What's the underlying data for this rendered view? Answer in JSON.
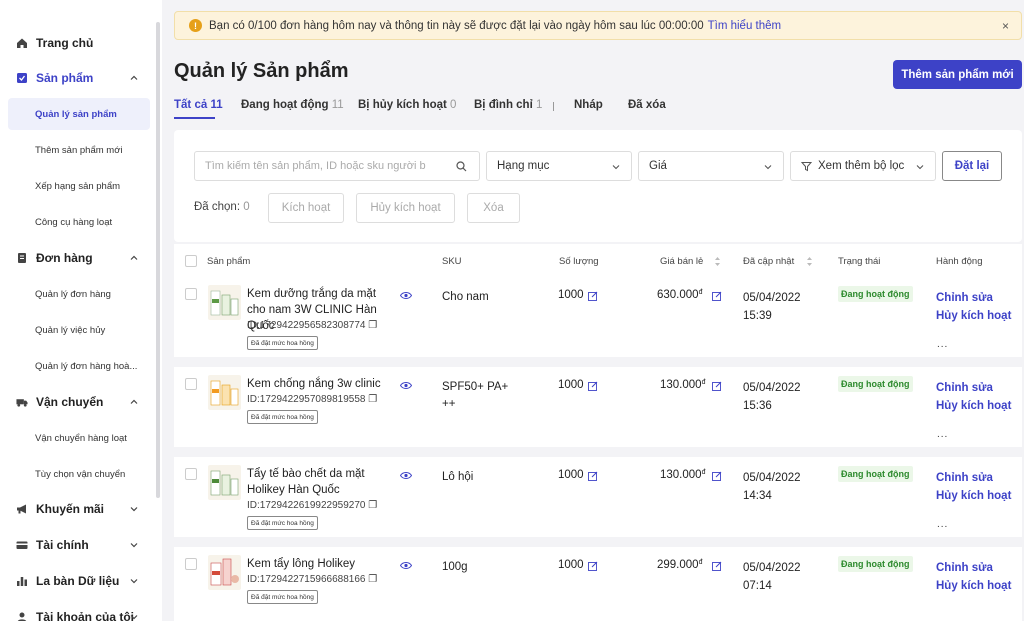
{
  "sidebar": {
    "sections": [
      {
        "label": "Trang chủ",
        "icon": "home-icon"
      },
      {
        "label": "Sản phẩm",
        "icon": "product-icon"
      },
      {
        "label": "Đơn hàng",
        "icon": "order-icon"
      },
      {
        "label": "Vận chuyển",
        "icon": "truck-icon"
      },
      {
        "label": "Khuyến mãi",
        "icon": "megaphone-icon"
      },
      {
        "label": "Tài chính",
        "icon": "card-icon"
      },
      {
        "label": "La bàn Dữ liệu",
        "icon": "bar-chart-icon"
      },
      {
        "label": "Tài khoản của tôi",
        "icon": "user-icon"
      }
    ],
    "product_items": [
      "Quản lý sản phẩm",
      "Thêm sản phẩm mới",
      "Xếp hạng sản phẩm",
      "Công cụ hàng loạt"
    ],
    "order_items": [
      "Quản lý đơn hàng",
      "Quản lý việc hủy",
      "Quản lý đơn hàng hoà..."
    ],
    "shipping_items": [
      "Vận chuyển hàng loạt",
      "Tùy chọn vận chuyển"
    ]
  },
  "banner": {
    "text": "Bạn có 0/100 đơn hàng hôm nay và thông tin này sẽ được đặt lại vào ngày hôm sau lúc 00:00:00",
    "link": "Tìm hiểu thêm",
    "close": "×"
  },
  "page": {
    "title": "Quản lý Sản phẩm",
    "add_button": "Thêm sản phẩm mới"
  },
  "tabs": [
    {
      "label": "Tất cả",
      "count": "11"
    },
    {
      "label": "Đang hoạt động",
      "count": "11"
    },
    {
      "label": "Bị hủy kích hoạt",
      "count": "0"
    },
    {
      "label": "Bị đình chỉ",
      "count": "1"
    },
    {
      "label": "Nháp",
      "count": ""
    },
    {
      "label": "Đã xóa",
      "count": ""
    }
  ],
  "filters": {
    "search_placeholder": "Tìm kiếm tên sản phẩm, ID hoặc sku người b",
    "category": "Hạng mục",
    "price": "Giá",
    "more_filters": "Xem thêm bộ lọc",
    "reset": "Đặt lại",
    "selected_label": "Đã chọn:",
    "selected_count": "0",
    "activate": "Kích hoạt",
    "deactivate": "Hủy kích hoạt",
    "delete": "Xóa"
  },
  "table": {
    "headers": {
      "product": "Sản phẩm",
      "sku": "SKU",
      "quantity": "Số lượng",
      "price": "Giá bán lẻ",
      "updated": "Đã cập nhật",
      "status": "Trạng thái",
      "action": "Hành động"
    },
    "rows": [
      {
        "name": "Kem dưỡng trắng da mặt cho nam 3W CLINIC Hàn Quốc",
        "id": "ID:1729422956582308774",
        "tag": "Đã đặt mức hoa hồng",
        "sku": "Cho nam",
        "qty": "1000",
        "price": "630.000",
        "currency": "đ",
        "date": "05/04/2022",
        "time": "15:39",
        "status": "Đang hoạt động",
        "edit": "Chỉnh sửa",
        "deactivate": "Hủy kích hoạt",
        "more": "..."
      },
      {
        "name": "Kem chống nắng 3w clinic",
        "id": "ID:1729422957089819558",
        "tag": "Đã đặt mức hoa hồng",
        "sku": "SPF50+ PA+ ++",
        "qty": "1000",
        "price": "130.000",
        "currency": "đ",
        "date": "05/04/2022",
        "time": "15:36",
        "status": "Đang hoạt động",
        "edit": "Chỉnh sửa",
        "deactivate": "Hủy kích hoạt",
        "more": "..."
      },
      {
        "name": "Tẩy tế bào chết da mặt Holikey Hàn Quốc",
        "id": "ID:1729422619922959270",
        "tag": "Đã đặt mức hoa hồng",
        "sku": "Lô hội",
        "qty": "1000",
        "price": "130.000",
        "currency": "đ",
        "date": "05/04/2022",
        "time": "14:34",
        "status": "Đang hoạt động",
        "edit": "Chỉnh sửa",
        "deactivate": "Hủy kích hoạt",
        "more": "..."
      },
      {
        "name": "Kem tẩy lông Holikey",
        "id": "ID:1729422715966688166",
        "tag": "Đã đặt mức hoa hồng",
        "sku": "100g",
        "qty": "1000",
        "price": "299.000",
        "currency": "đ",
        "date": "05/04/2022",
        "time": "07:14",
        "status": "Đang hoạt động",
        "edit": "Chỉnh sửa",
        "deactivate": "Hủy kích hoạt",
        "more": "..."
      }
    ]
  },
  "colors": {
    "accent": "#3d42c7",
    "status_green": "#2d8a2d",
    "banner_bg": "#fdf3dc"
  }
}
